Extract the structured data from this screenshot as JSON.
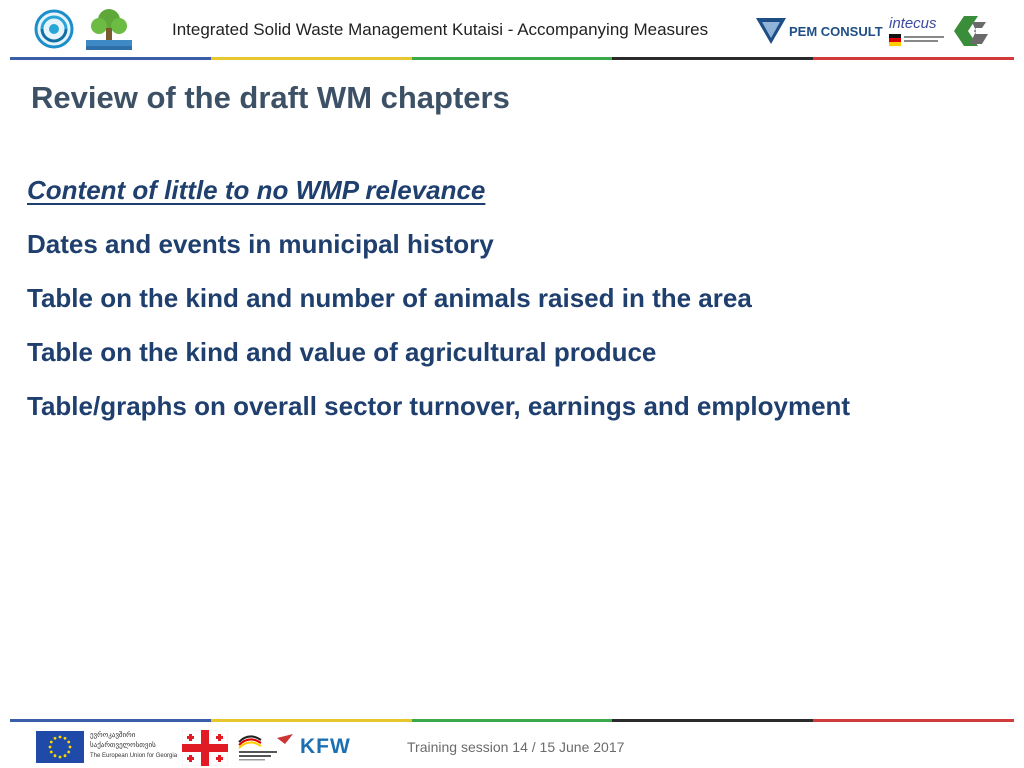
{
  "header": {
    "title": "Integrated Solid Waste Management Kutaisi - Accompanying Measures",
    "partner_logo_text": "PEM CONSULT",
    "intecus_logo_text": "intecus"
  },
  "slide": {
    "title": "Review of the draft WM chapters",
    "subheading": "Content of little to no WMP relevance",
    "items": [
      "Dates and events in municipal history",
      "Table on the kind and number of animals raised in the area",
      "Table on the kind and value of agricultural produce",
      "Table/graphs on overall sector turnover, earnings and employment"
    ]
  },
  "footer": {
    "session_text": "Training session 14 / 15 June 2017",
    "eu_line1": "ევროკავშირი",
    "eu_line2": "საქართველოსთვის",
    "eu_line3": "The European Union for Georgia",
    "kfw_text": "KFW"
  },
  "colors": {
    "stripe": [
      "#3a5fa8",
      "#e8c62e",
      "#3aa94a",
      "#2b2b2b",
      "#d23b3b"
    ],
    "title": "#3d5166",
    "body_text": "#1f3f6e"
  }
}
